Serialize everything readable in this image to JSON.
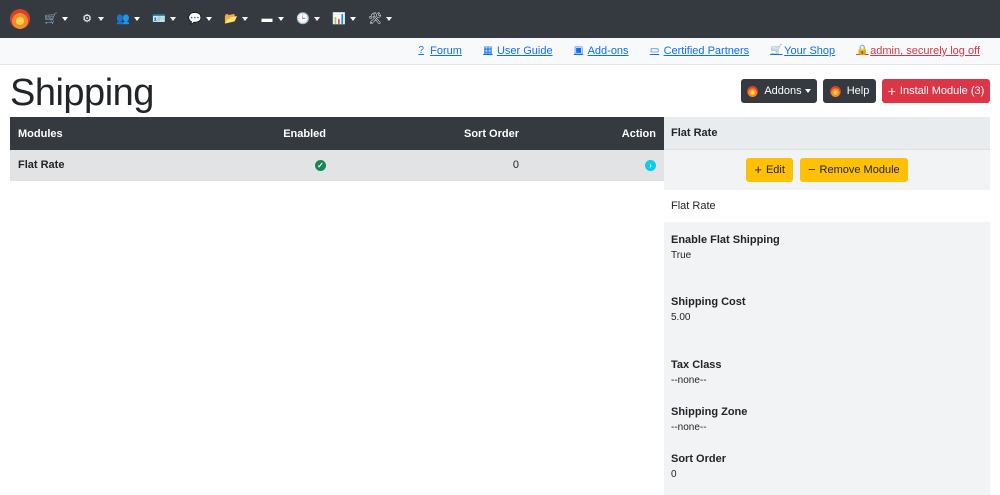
{
  "nav": {
    "items": [
      {
        "name": "catalog",
        "icon": "cart-icon",
        "glyph": "🛒"
      },
      {
        "name": "modules",
        "icon": "cogs-icon",
        "glyph": "⚙"
      },
      {
        "name": "customers",
        "icon": "users-icon",
        "glyph": "👥"
      },
      {
        "name": "configuration",
        "icon": "id-card-icon",
        "glyph": "🪪"
      },
      {
        "name": "localization",
        "icon": "comments-icon",
        "glyph": "💬"
      },
      {
        "name": "reports",
        "icon": "folder-icon",
        "glyph": "📂"
      },
      {
        "name": "payments",
        "icon": "credit-card-icon",
        "glyph": "▬"
      },
      {
        "name": "history",
        "icon": "clock-icon",
        "glyph": "🕒"
      },
      {
        "name": "statistics",
        "icon": "chart-icon",
        "glyph": "📊"
      },
      {
        "name": "tools",
        "icon": "tools-icon",
        "glyph": "🛠"
      }
    ]
  },
  "subbar": {
    "forum": "Forum",
    "user_guide": "User Guide",
    "addons": "Add-ons",
    "certified_partners": "Certified Partners",
    "your_shop": "Your Shop",
    "logout": "admin, securely log off"
  },
  "page": {
    "title": "Shipping"
  },
  "buttons": {
    "addons": "Addons",
    "help": "Help",
    "install": "Install Module (3)"
  },
  "table": {
    "headers": {
      "modules": "Modules",
      "enabled": "Enabled",
      "sort_order": "Sort Order",
      "action": "Action"
    },
    "rows": [
      {
        "module": "Flat Rate",
        "sort_order": "0"
      }
    ]
  },
  "panel": {
    "title": "Flat Rate",
    "edit": "Edit",
    "remove": "Remove Module",
    "name": "Flat Rate",
    "fields": [
      {
        "label": "Enable Flat Shipping",
        "value": "True"
      },
      {
        "label": "Shipping Cost",
        "value": "5.00"
      },
      {
        "label": "Tax Class",
        "value": "--none--"
      },
      {
        "label": "Shipping Zone",
        "value": "--none--"
      },
      {
        "label": "Sort Order",
        "value": "0"
      }
    ]
  },
  "colors": {
    "navbar": "#343a40",
    "link": "#0d6efd",
    "danger": "#dc3545",
    "warning": "#ffc107",
    "success": "#198754",
    "info": "#0dcaf0"
  }
}
